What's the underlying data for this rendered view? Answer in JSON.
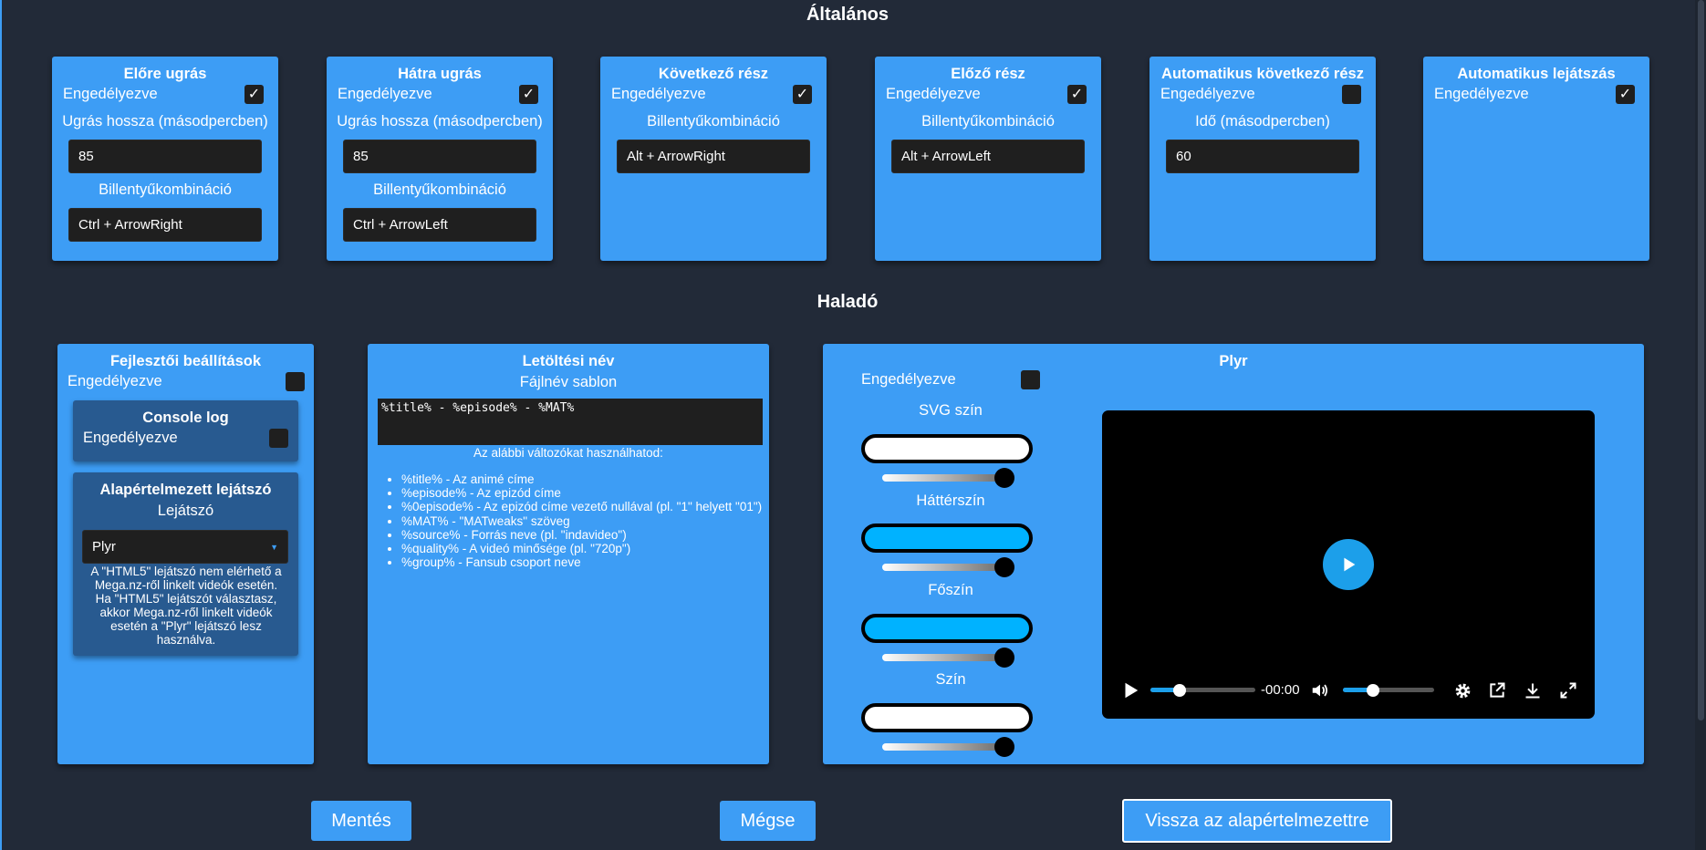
{
  "sections": {
    "general": "Általános",
    "advanced": "Haladó"
  },
  "common": {
    "enabled": "Engedélyezve",
    "checkmark": "✓"
  },
  "forward_skip": {
    "title": "Előre ugrás",
    "enabled": true,
    "length_label": "Ugrás hossza (másodpercben)",
    "length_value": "85",
    "shortcut_label": "Billentyűkombináció",
    "shortcut_value": "Ctrl + ArrowRight"
  },
  "backward_skip": {
    "title": "Hátra ugrás",
    "enabled": true,
    "length_label": "Ugrás hossza (másodpercben)",
    "length_value": "85",
    "shortcut_label": "Billentyűkombináció",
    "shortcut_value": "Ctrl + ArrowLeft"
  },
  "next_episode": {
    "title": "Következő rész",
    "enabled": true,
    "shortcut_label": "Billentyűkombináció",
    "shortcut_value": "Alt + ArrowRight"
  },
  "prev_episode": {
    "title": "Előző rész",
    "enabled": true,
    "shortcut_label": "Billentyűkombináció",
    "shortcut_value": "Alt + ArrowLeft"
  },
  "auto_next": {
    "title": "Automatikus következő rész",
    "enabled": false,
    "time_label": "Idő (másodpercben)",
    "time_value": "60"
  },
  "autoplay": {
    "title": "Automatikus lejátszás",
    "enabled": true
  },
  "dev": {
    "title": "Fejlesztői beállítások",
    "enabled": false,
    "console_log": {
      "title": "Console log",
      "enabled": false
    },
    "default_player": {
      "title": "Alapértelmezett lejátszó",
      "label": "Lejátszó",
      "selected": "Plyr",
      "note": "A \"HTML5\" lejátszó nem elérhető a Mega.nz-ről linkelt videók esetén. Ha \"HTML5\" lejátszót választasz, akkor Mega.nz-ről linkelt videók esetén a \"Plyr\" lejátszó lesz használva."
    }
  },
  "download_name": {
    "title": "Letöltési név",
    "template_label": "Fájlnév sablon",
    "template_value": "%title% - %episode% - %MAT%",
    "variables_intro": "Az alábbi változókat használhatod:",
    "variables": [
      "%title% - Az animé címe",
      "%episode% - Az epizód címe",
      "%0episode% - Az epizód címe vezető nullával (pl. \"1\" helyett \"01\")",
      "%MAT% - \"MATweaks\" szöveg",
      "%source% - Forrás neve (pl. \"indavideo\")",
      "%quality% - A videó minősége (pl. \"720p\")",
      "%group% - Fansub csoport neve"
    ]
  },
  "plyr": {
    "title": "Plyr",
    "enabled": false,
    "colors": [
      {
        "label": "SVG szín",
        "color": "#ffffff",
        "opacity": 1.0
      },
      {
        "label": "Háttérszín",
        "color": "#00b2ff",
        "opacity": 1.0
      },
      {
        "label": "Főszín",
        "color": "#00b2ff",
        "opacity": 1.0
      },
      {
        "label": "Szín",
        "color": "#ffffff",
        "opacity": 1.0
      }
    ],
    "preview": {
      "time": "-00:00",
      "progress": 0.28,
      "volume": 0.33,
      "accent": "#1c9fea"
    }
  },
  "buttons": {
    "save": "Mentés",
    "cancel": "Mégse",
    "reset": "Vissza az alapértelmezettre"
  },
  "colors": {
    "accent": "#3d9df5",
    "background": "#222a38",
    "subcard": "#285a90"
  }
}
